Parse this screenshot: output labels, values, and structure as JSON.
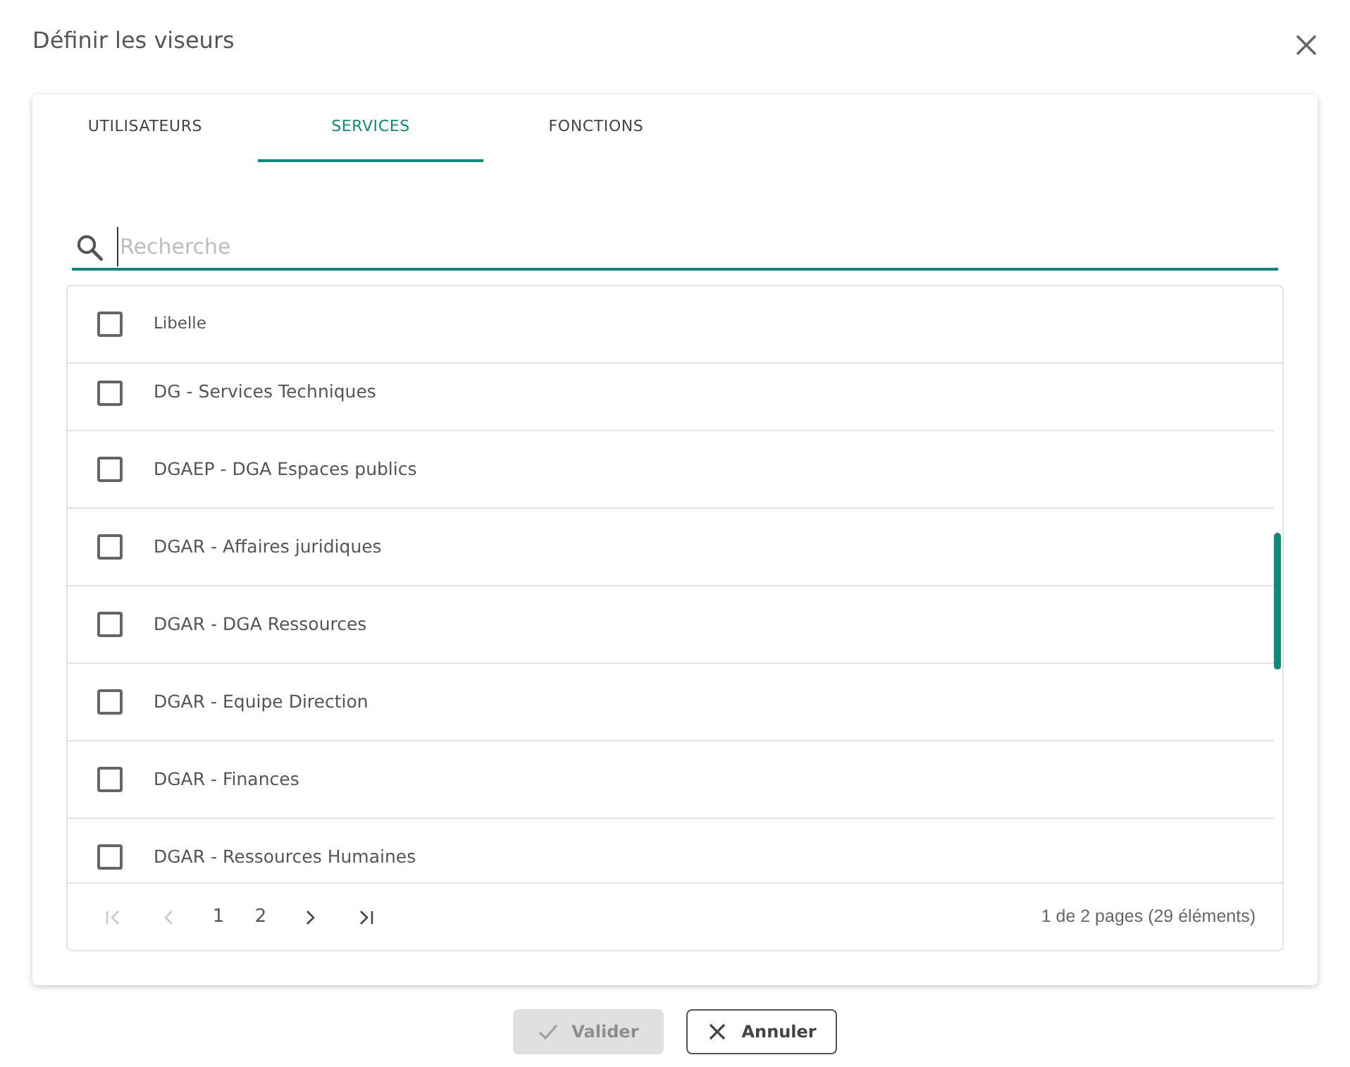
{
  "dialog": {
    "title": "Définir les viseurs"
  },
  "tabs": [
    {
      "label": "UTILISATEURS",
      "selected": false
    },
    {
      "label": "SERVICES",
      "selected": true
    },
    {
      "label": "FONCTIONS",
      "selected": false
    }
  ],
  "search": {
    "placeholder": "Recherche"
  },
  "table": {
    "select_all_checked": false,
    "columns": [
      "Libelle"
    ],
    "rows": [
      {
        "label": "DG - Services Techniques",
        "checked": false
      },
      {
        "label": "DGAEP - DGA Espaces publics",
        "checked": false
      },
      {
        "label": "DGAR - Affaires juridiques",
        "checked": false
      },
      {
        "label": "DGAR - DGA Ressources",
        "checked": false
      },
      {
        "label": "DGAR - Equipe Direction",
        "checked": false
      },
      {
        "label": "DGAR - Finances",
        "checked": false
      },
      {
        "label": "DGAR - Ressources Humaines",
        "checked": false
      }
    ]
  },
  "pager": {
    "items": [
      {
        "kind": "first",
        "disabled": true
      },
      {
        "kind": "prev",
        "disabled": true
      },
      {
        "kind": "page",
        "label": "1"
      },
      {
        "kind": "page",
        "label": "2"
      },
      {
        "kind": "next",
        "disabled": false
      },
      {
        "kind": "last",
        "disabled": false
      }
    ],
    "summary": "1 de 2 pages (29 éléments)"
  },
  "buttons": [
    {
      "kind": "confirm",
      "label": "Valider",
      "disabled": true
    },
    {
      "kind": "cancel",
      "label": "Annuler",
      "disabled": false
    }
  ]
}
